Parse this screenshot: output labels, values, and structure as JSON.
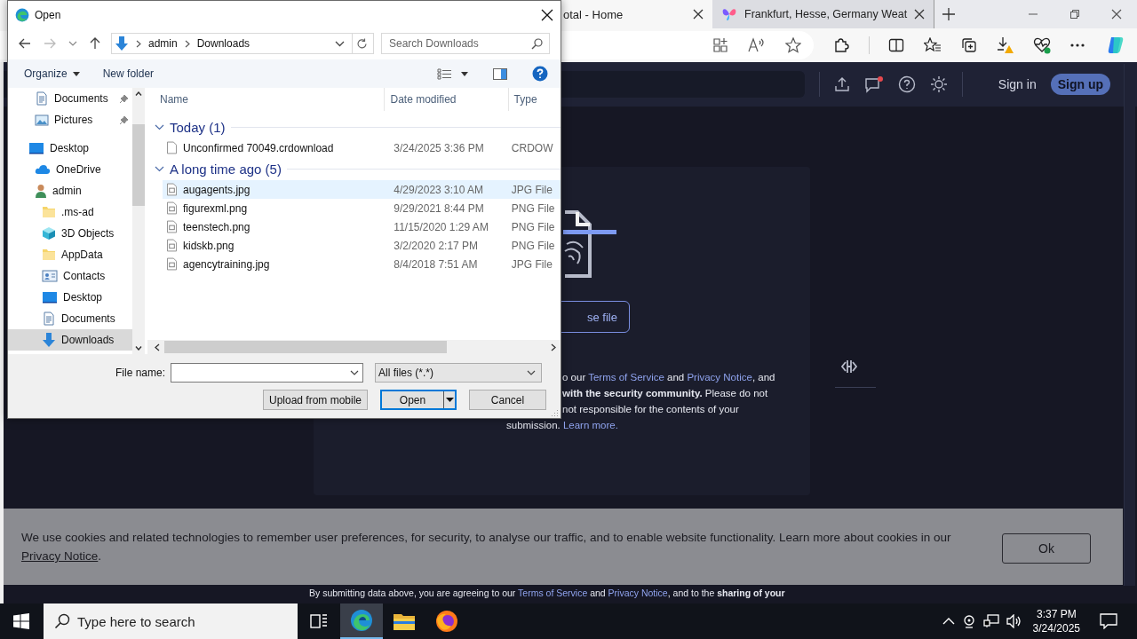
{
  "browser": {
    "tabs": [
      {
        "title": "otal - Home",
        "selected": true
      },
      {
        "title": "Frankfurt, Hesse, Germany Weat",
        "selected": false
      }
    ]
  },
  "page": {
    "sign_in": "Sign in",
    "sign_up": "Sign up",
    "has_notification": true,
    "choose_button": "se file",
    "notice_lines": [
      {
        "segments": [
          {
            "text": "o our ",
            "kind": "text"
          },
          {
            "text": "Terms of Service",
            "kind": "link"
          },
          {
            "text": " and ",
            "kind": "text"
          },
          {
            "text": "Privacy Notice",
            "kind": "link"
          },
          {
            "text": ", and",
            "kind": "text"
          }
        ]
      },
      {
        "segments": [
          {
            "text": "with the security community.",
            "kind": "bold"
          },
          {
            "text": " Please do not",
            "kind": "text"
          }
        ]
      },
      {
        "segments": [
          {
            "text": "not responsible for the contents of your",
            "kind": "text"
          }
        ]
      },
      {
        "segments": [
          {
            "text": "submission. ",
            "kind": "text"
          },
          {
            "text": "Learn more.",
            "kind": "link"
          }
        ]
      }
    ],
    "footer_segments": [
      {
        "text": "By submitting data above, you are agreeing to our ",
        "kind": "text"
      },
      {
        "text": "Terms of Service",
        "kind": "link"
      },
      {
        "text": " and ",
        "kind": "text"
      },
      {
        "text": "Privacy Notice",
        "kind": "link"
      },
      {
        "text": ", and to the ",
        "kind": "text"
      },
      {
        "text": "sharing of your",
        "kind": "bold"
      }
    ],
    "cookie": {
      "text": "We use cookies and related technologies to remember user preferences, for security, to analyse our traffic, and to enable website functionality. Learn more about cookies in our ",
      "link": "Privacy Notice",
      "after": ".",
      "button": "Ok"
    }
  },
  "dialog": {
    "title": "Open",
    "path": [
      "admin",
      "Downloads"
    ],
    "search_placeholder": "Search Downloads",
    "organize": "Organize",
    "new_folder": "New folder",
    "nav": [
      {
        "label": "Documents",
        "kind": "document",
        "pinned": true,
        "selected": false
      },
      {
        "label": "Pictures",
        "kind": "picture",
        "pinned": true,
        "selected": false
      },
      {
        "label": "Desktop",
        "kind": "desktop",
        "pinned": false,
        "selected": false,
        "children": [
          {
            "label": "OneDrive",
            "kind": "cloud",
            "pinned": false,
            "selected": false
          },
          {
            "label": "admin",
            "kind": "user",
            "pinned": false,
            "selected": false,
            "children": [
              {
                "label": ".ms-ad",
                "kind": "folder",
                "pinned": false,
                "selected": false
              },
              {
                "label": "3D Objects",
                "kind": "cube",
                "pinned": false,
                "selected": false
              },
              {
                "label": "AppData",
                "kind": "folder",
                "pinned": false,
                "selected": false
              },
              {
                "label": "Contacts",
                "kind": "contacts",
                "pinned": false,
                "selected": false
              },
              {
                "label": "Desktop",
                "kind": "desktop",
                "pinned": false,
                "selected": false
              },
              {
                "label": "Documents",
                "kind": "document",
                "pinned": false,
                "selected": false
              },
              {
                "label": "Downloads",
                "kind": "download",
                "pinned": false,
                "selected": true
              }
            ]
          }
        ]
      }
    ],
    "columns": [
      "Name",
      "Date modified",
      "Type"
    ],
    "groups": [
      {
        "label": "Today (1)",
        "expanded": true,
        "files": [
          {
            "name": "Unconfirmed 70049.crdownload",
            "date": "3/24/2025 3:36 PM",
            "type": "CRDOW",
            "kind": "blank",
            "selected": false
          }
        ]
      },
      {
        "label": "A long time ago (5)",
        "expanded": true,
        "files": [
          {
            "name": "augagents.jpg",
            "date": "4/29/2023 3:10 AM",
            "type": "JPG File",
            "kind": "image",
            "selected": true
          },
          {
            "name": "figurexml.png",
            "date": "9/29/2021 8:44 PM",
            "type": "PNG File",
            "kind": "image",
            "selected": false
          },
          {
            "name": "teenstech.png",
            "date": "11/15/2020 1:29 AM",
            "type": "PNG File",
            "kind": "image",
            "selected": false
          },
          {
            "name": "kidskb.png",
            "date": "3/2/2020 2:17 PM",
            "type": "PNG File",
            "kind": "image",
            "selected": false
          },
          {
            "name": "agencytraining.jpg",
            "date": "8/4/2018 7:51 AM",
            "type": "JPG File",
            "kind": "image",
            "selected": false
          }
        ]
      }
    ],
    "file_name_label": "File name:",
    "file_type": "All files (*.*)",
    "buttons": [
      {
        "label": "Upload from mobile",
        "kind": "plain"
      },
      {
        "label": "Open",
        "kind": "split"
      },
      {
        "label": "Cancel",
        "kind": "plain"
      }
    ]
  },
  "taskbar": {
    "search_placeholder": "Type here to search",
    "time": "3:37 PM",
    "date": "3/24/2025",
    "apps": [
      {
        "kind": "edge",
        "active": true
      },
      {
        "kind": "explorer",
        "active": false
      },
      {
        "kind": "firefox",
        "active": false
      }
    ]
  }
}
